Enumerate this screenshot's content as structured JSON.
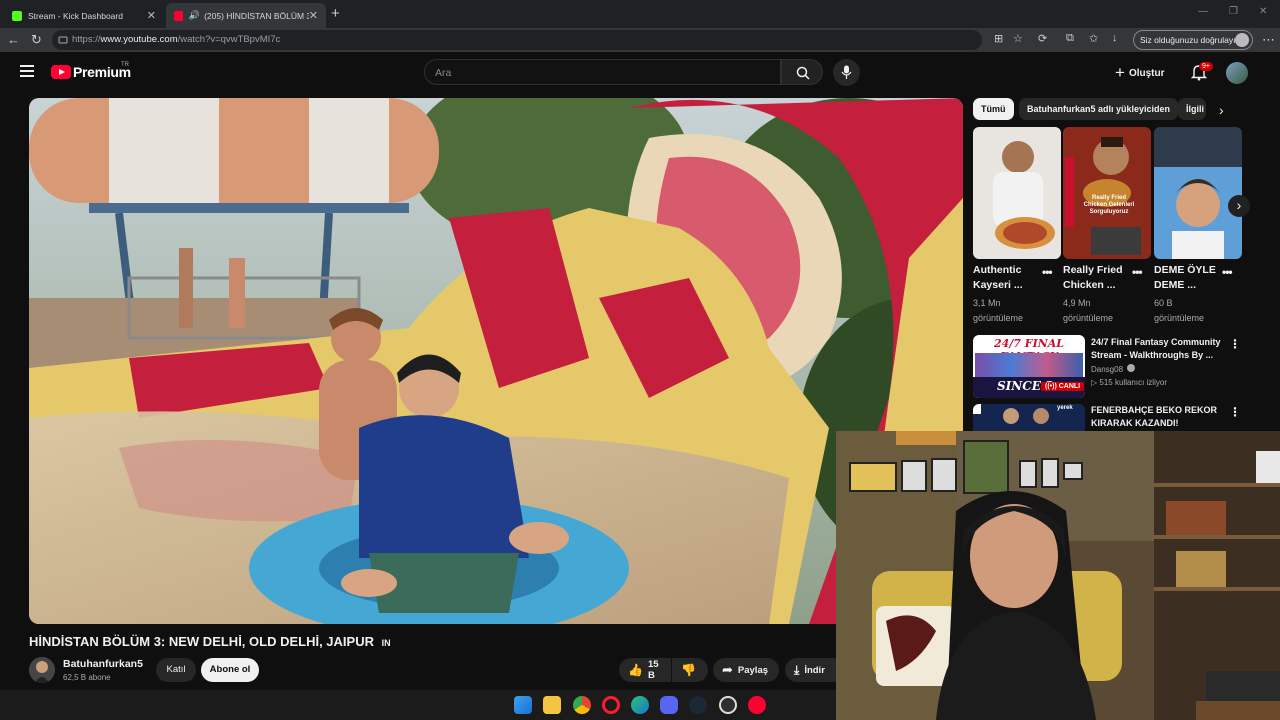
{
  "browser": {
    "tabs": [
      {
        "title": "Stream - Kick Dashboard",
        "active": false
      },
      {
        "title": "(205) HİNDİSTAN BÖLÜM 3: N",
        "active": true
      }
    ],
    "url_prefix": "https://",
    "url_domain": "www.youtube.com",
    "url_path": "/watch?v=qvwTBpvMI7c",
    "signin_label": "Siz olduğunuzu doğrulayın"
  },
  "header": {
    "logo_text": "Premium",
    "logo_region": "TR",
    "search_placeholder": "Ara",
    "create_label": "Oluştur",
    "notif_badge": "9+"
  },
  "video": {
    "title": "HİNDİSTAN BÖLÜM 3: NEW DELHİ, OLD DELHİ, JAIPUR",
    "flag": "IN",
    "channel": "Batuhanfurkan5",
    "subscribers": "62,5 B abone",
    "join_label": "Katıl",
    "subscribe_label": "Abone ol",
    "likes": "15 B",
    "share_label": "Paylaş",
    "download_label": "İndir"
  },
  "sidebar": {
    "chips": [
      "Tümü",
      "Batuhanfurkan5 adlı yükleyiciden",
      "İlgili"
    ],
    "shorts": [
      {
        "title_l1": "Authentic",
        "title_l2": "Kayseri ...",
        "views_l1": "3,1 Mn",
        "views_l2": "görüntüleme"
      },
      {
        "title_l1": "Really Fried",
        "title_l2": "Chicken ...",
        "views_l1": "4,9 Mn",
        "views_l2": "görüntüleme"
      },
      {
        "title_l1": "DEME ÖYLE",
        "title_l2": "DEME ...",
        "views_l1": "60 B",
        "views_l2": "görüntüleme"
      }
    ],
    "short_overlay_text": "Really Fried Chicken Gelenleri Sorguluyoruz",
    "recommended": [
      {
        "title": "24/7 Final Fantasy Community Stream - Walkthroughs By ...",
        "channel": "Dansg08",
        "meta": "515 kullanıcı izliyor",
        "thumb_l1": "24/7 FINAL FANTASY",
        "thumb_l2": "SINCE 2",
        "live_label": "CANLI"
      },
      {
        "title": "FENERBAHÇE BEKO REKOR KIRARAK KAZANDI! Fenerbah...",
        "thumb_badge": "yerek"
      }
    ]
  },
  "colors": {
    "accent_red": "#ff0033",
    "live_red": "#cc0000",
    "bg": "#0f0f0f",
    "chip_bg": "#272727"
  }
}
